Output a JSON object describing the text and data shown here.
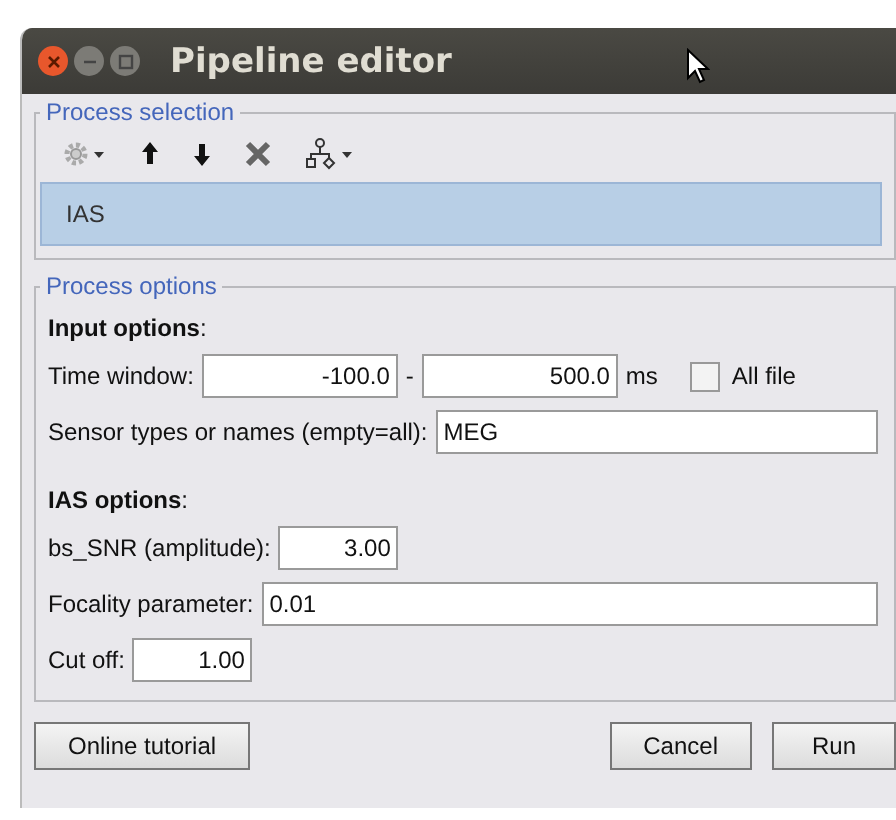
{
  "window": {
    "title": "Pipeline editor"
  },
  "process_selection": {
    "legend": "Process selection",
    "items": [
      {
        "label": "IAS",
        "selected": true
      }
    ]
  },
  "process_options": {
    "legend": "Process options",
    "rows": [
      {
        "kind": "heading",
        "label": "Input options",
        "suffix": ":"
      },
      {
        "kind": "range",
        "label": "Time window:",
        "from": "-100.0",
        "separator": "-",
        "to": "500.0",
        "unit": "ms",
        "checkbox": {
          "label": "All file",
          "checked": false
        }
      },
      {
        "kind": "text",
        "label": "Sensor types or names (empty=all):",
        "value": "MEG"
      },
      {
        "kind": "spacer"
      },
      {
        "kind": "heading",
        "label": "IAS options",
        "suffix": ":"
      },
      {
        "kind": "number",
        "label": "bs_SNR (amplitude):",
        "value": "3.00"
      },
      {
        "kind": "text",
        "label": "Focality parameter:",
        "value": "0.01"
      },
      {
        "kind": "number",
        "label": "Cut off:",
        "value": "1.00"
      }
    ]
  },
  "buttons": {
    "left": [
      "Online tutorial"
    ],
    "right": [
      "Cancel",
      "Run"
    ]
  }
}
